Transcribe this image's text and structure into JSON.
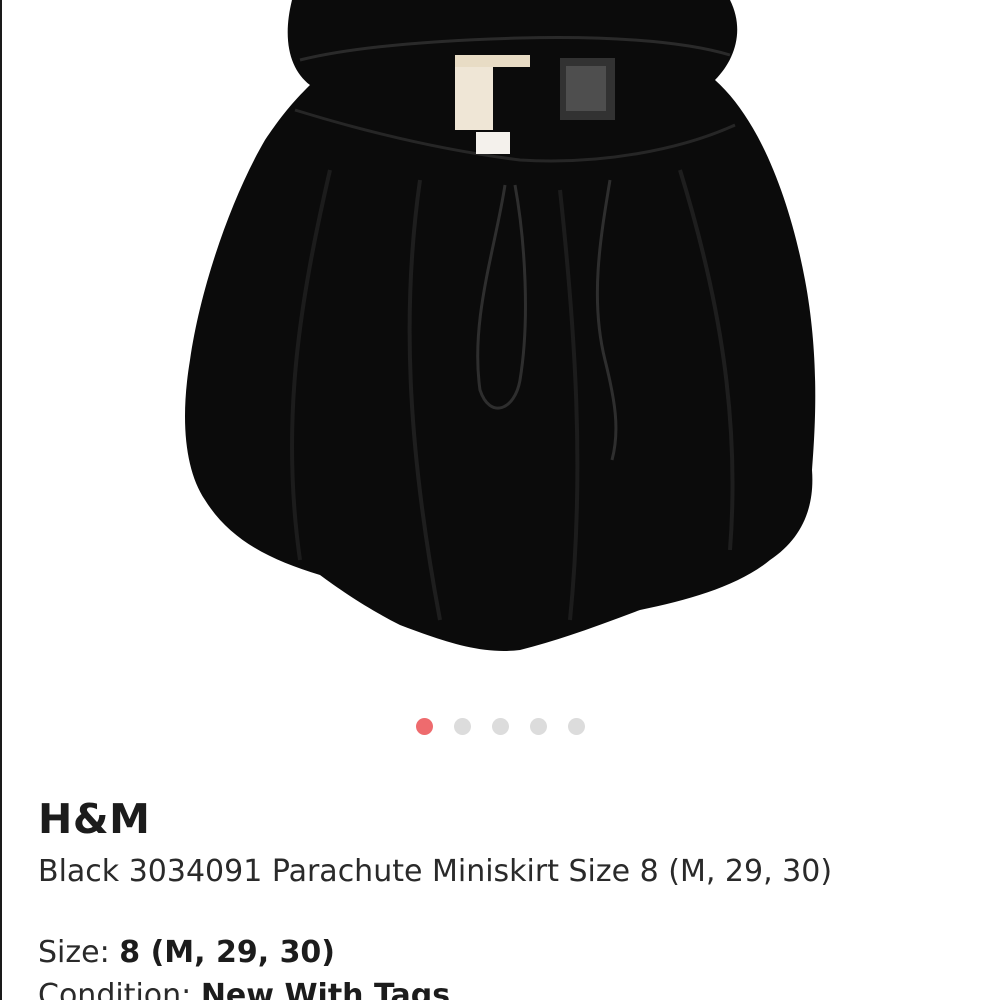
{
  "listing": {
    "brand": "H&M",
    "title": "Black 3034091 Parachute Miniskirt Size 8 (M, 29, 30)",
    "size_label": "Size:",
    "size_value": "8 (M, 29, 30)",
    "condition_label": "Condition:",
    "condition_value": "New With Tags"
  },
  "carousel": {
    "image_count": 5,
    "active_index": 0,
    "active_color": "#ee6b6e",
    "inactive_color": "#dcdcdc"
  },
  "colors": {
    "garment": "#0b0b0b",
    "background": "#ffffff"
  }
}
